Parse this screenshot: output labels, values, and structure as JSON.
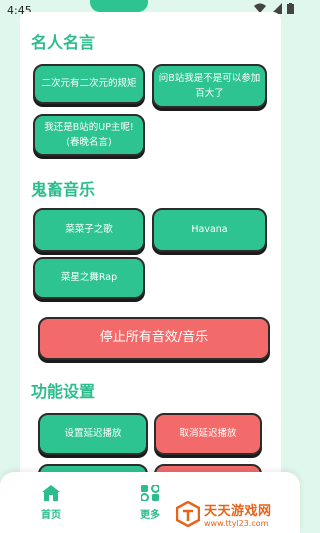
{
  "status_bar": {
    "time": "4:45"
  },
  "sections": {
    "famous_quotes": {
      "title": "名人名言",
      "buttons": [
        "二次元有二次元的规矩",
        "问B站我是不是可以参加百大了",
        "我还是B站的UP主呢!(春晚名言)"
      ]
    },
    "ghost_music": {
      "title": "鬼畜音乐",
      "buttons": [
        "菜菜子之歌",
        "Havana",
        "菜星之舞Rap"
      ]
    },
    "stop_all": {
      "label": "停止所有音效/音乐"
    },
    "settings": {
      "title": "功能设置",
      "buttons": [
        "设置延迟播放",
        "取消延迟播放"
      ]
    }
  },
  "bottom_nav": {
    "items": [
      {
        "label": "首页",
        "icon": "home-icon"
      },
      {
        "label": "更多",
        "icon": "more-icon"
      }
    ]
  },
  "watermark": {
    "title": "天天游戏网",
    "url": "www.ttyl23.com"
  },
  "colors": {
    "accent": "#2ec492",
    "title": "#2bbd8c",
    "danger": "#f36a6a",
    "background": "#dff7ec"
  }
}
